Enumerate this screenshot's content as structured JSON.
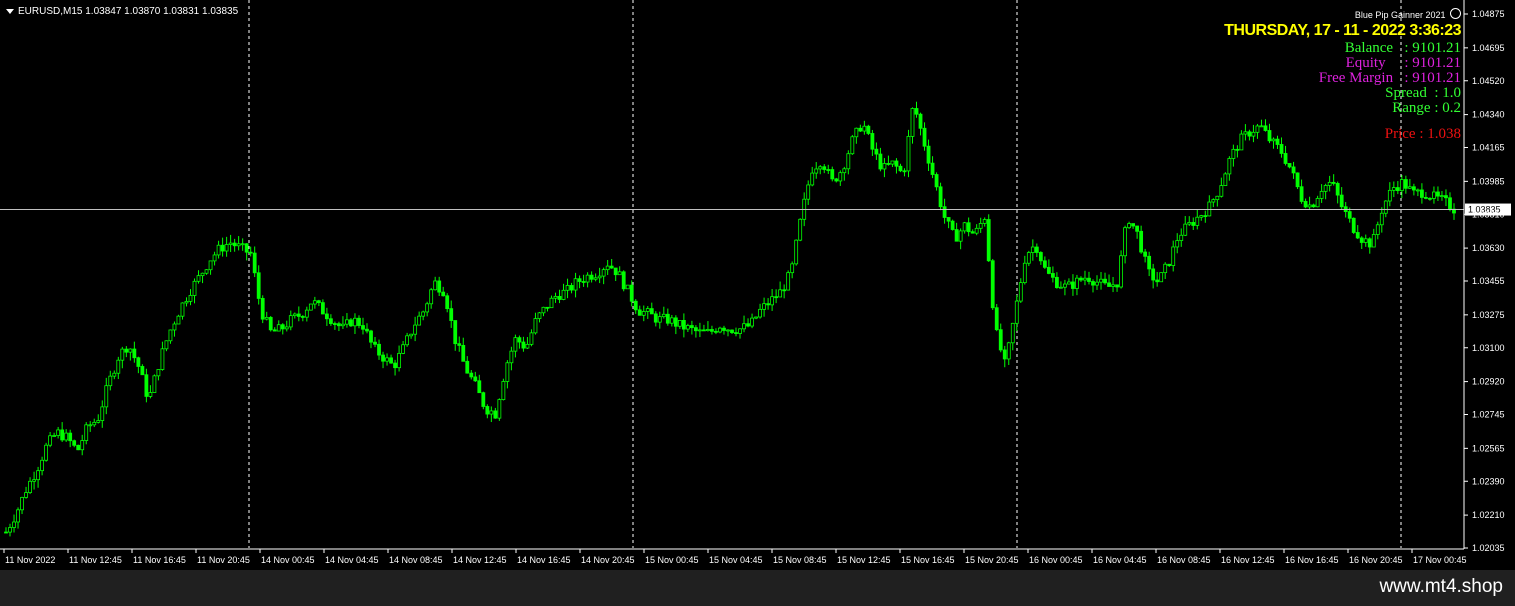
{
  "header": {
    "symbol_info": "EURUSD,M15  1.03847 1.03870 1.03831 1.03835"
  },
  "ea": {
    "name": "Blue Pip Gainner 2021",
    "datetime": "THURSDAY, 17 - 11 - 2022 3:36:23",
    "lines": [
      {
        "text": "Balance   : 9101.21",
        "color": "#33ff33"
      },
      {
        "text": "Equity     : 9101.21",
        "color": "#dd22dd"
      },
      {
        "text": "Free Margin   : 9101.21",
        "color": "#dd22dd"
      },
      {
        "text": "Spread  : 1.0",
        "color": "#33ff33"
      },
      {
        "text": "Range : 0.2",
        "color": "#33ff33"
      }
    ],
    "price_line": {
      "text": "Price : 1.038",
      "color": "#ee1111"
    }
  },
  "footer": {
    "url": "www.mt4.shop"
  },
  "colors": {
    "candle": "#00ff00",
    "background": "#000000",
    "axis_text": "#ffffff",
    "grid": "#ffffff"
  },
  "chart_data": {
    "type": "candlestick",
    "symbol": "EURUSD",
    "timeframe": "M15",
    "current_price": "1.03835",
    "ylim": [
      1.02035,
      1.04875
    ],
    "price_ticks": [
      "1.04875",
      "1.04695",
      "1.04520",
      "1.04340",
      "1.04165",
      "1.03985",
      "1.03810",
      "1.03630",
      "1.03455",
      "1.03275",
      "1.03100",
      "1.02920",
      "1.02745",
      "1.02565",
      "1.02390",
      "1.02210",
      "1.02035"
    ],
    "time_ticks": [
      "11 Nov 2022",
      "11 Nov 12:45",
      "11 Nov 16:45",
      "11 Nov 20:45",
      "14 Nov 00:45",
      "14 Nov 04:45",
      "14 Nov 08:45",
      "14 Nov 12:45",
      "14 Nov 16:45",
      "14 Nov 20:45",
      "15 Nov 00:45",
      "15 Nov 04:45",
      "15 Nov 08:45",
      "15 Nov 12:45",
      "15 Nov 16:45",
      "15 Nov 20:45",
      "16 Nov 00:45",
      "16 Nov 04:45",
      "16 Nov 08:45",
      "16 Nov 12:45",
      "16 Nov 16:45",
      "16 Nov 20:45",
      "17 Nov 00:45"
    ],
    "day_separators": [
      "14 Nov 2022",
      "15 Nov 2022",
      "16 Nov 2022",
      "17 Nov 2022"
    ],
    "close_path": [
      1.0212,
      1.0222,
      1.0235,
      1.0245,
      1.0258,
      1.0265,
      1.0262,
      1.0255,
      1.0268,
      1.0272,
      1.029,
      1.0305,
      1.0312,
      1.03,
      1.0282,
      1.0302,
      1.0318,
      1.033,
      1.034,
      1.0348,
      1.0357,
      1.0363,
      1.0366,
      1.0363,
      1.036,
      1.033,
      1.0318,
      1.032,
      1.0325,
      1.0328,
      1.0335,
      1.033,
      1.0325,
      1.032,
      1.0325,
      1.0322,
      1.031,
      1.0305,
      1.03,
      1.031,
      1.0322,
      1.033,
      1.0345,
      1.034,
      1.0315,
      1.03,
      1.029,
      1.0278,
      1.0275,
      1.03,
      1.0315,
      1.031,
      1.0325,
      1.0332,
      1.0338,
      1.034,
      1.0345,
      1.0348,
      1.035,
      1.0355,
      1.035,
      1.034,
      1.033,
      1.0328,
      1.0325,
      1.0325,
      1.0322,
      1.032,
      1.0318,
      1.0318,
      1.0322,
      1.032,
      1.032,
      1.0322,
      1.033,
      1.0335,
      1.034,
      1.035,
      1.038,
      1.0405,
      1.041,
      1.0398,
      1.0405,
      1.042,
      1.043,
      1.0415,
      1.0405,
      1.0408,
      1.0402,
      1.044,
      1.042,
      1.04,
      1.038,
      1.0368,
      1.0375,
      1.037,
      1.038,
      1.032,
      1.03,
      1.033,
      1.036,
      1.0365,
      1.035,
      1.0345,
      1.0342,
      1.0345,
      1.0348,
      1.0345,
      1.0342,
      1.0345,
      1.038,
      1.037,
      1.035,
      1.0345,
      1.0355,
      1.037,
      1.0375,
      1.038,
      1.0385,
      1.0395,
      1.041,
      1.042,
      1.0425,
      1.0428,
      1.042,
      1.0415,
      1.0405,
      1.039,
      1.0385,
      1.0395,
      1.0398,
      1.0385,
      1.0375,
      1.0368,
      1.0365,
      1.0385,
      1.0395,
      1.0398,
      1.0392,
      1.0393,
      1.039,
      1.0388,
      1.0384
    ]
  }
}
